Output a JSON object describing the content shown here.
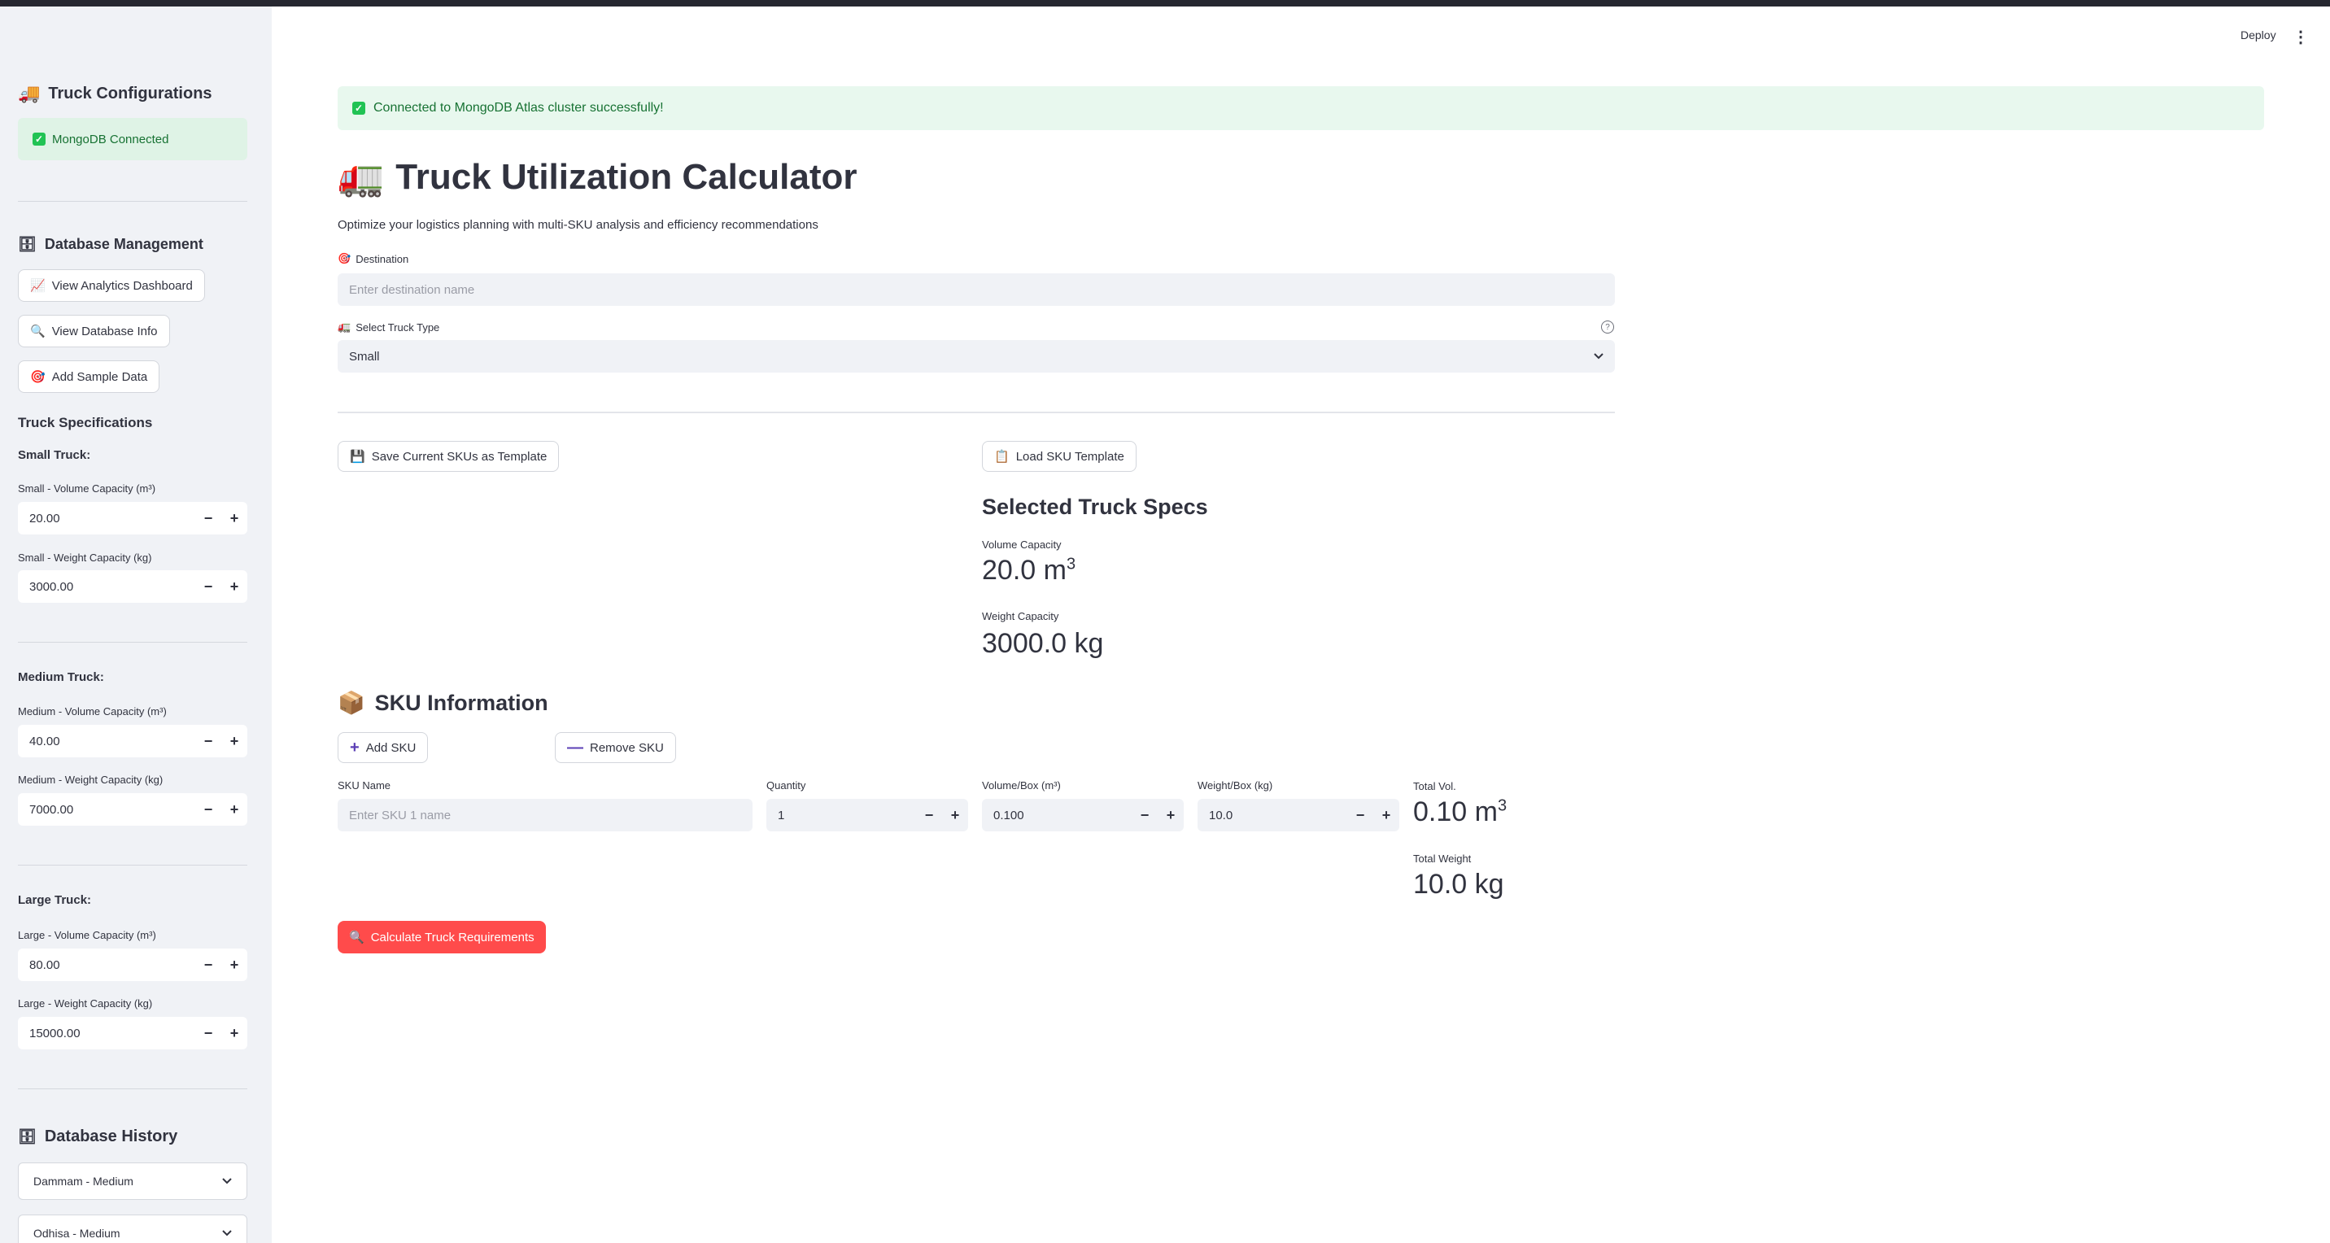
{
  "header": {
    "deploy_label": "Deploy",
    "menu_icon": "⋮"
  },
  "sidebar": {
    "title_icon": "🚚",
    "title": "Truck Configurations",
    "mongo_status": "MongoDB Connected",
    "db_mgmt_icon": "🗄",
    "db_mgmt_title": "Database Management",
    "buttons": [
      {
        "icon": "📈",
        "label": "View Analytics Dashboard"
      },
      {
        "icon": "🔍",
        "label": "View Database Info"
      },
      {
        "icon": "🎯",
        "label": "Add Sample Data"
      }
    ],
    "specs_title": "Truck Specifications",
    "small": {
      "title": "Small Truck:",
      "vol_label": "Small - Volume Capacity (m³)",
      "vol_value": "20.00",
      "wt_label": "Small - Weight Capacity (kg)",
      "wt_value": "3000.00"
    },
    "medium": {
      "title": "Medium Truck:",
      "vol_label": "Medium - Volume Capacity (m³)",
      "vol_value": "40.00",
      "wt_label": "Medium - Weight Capacity (kg)",
      "wt_value": "7000.00"
    },
    "large": {
      "title": "Large Truck:",
      "vol_label": "Large - Volume Capacity (m³)",
      "vol_value": "80.00",
      "wt_label": "Large - Weight Capacity (kg)",
      "wt_value": "15000.00"
    },
    "history_icon": "🗄",
    "history_title": "Database History",
    "history_items": [
      "Dammam - Medium",
      "Odhisa - Medium"
    ]
  },
  "main": {
    "alert": "Connected to MongoDB Atlas cluster successfully!",
    "title_icon": "🚛",
    "title": "Truck Utilization Calculator",
    "caption": "Optimize your logistics planning with multi-SKU analysis and efficiency recommendations",
    "destination_icon": "🎯",
    "destination_label": "Destination",
    "destination_placeholder": "Enter destination name",
    "truck_type_icon": "🚛",
    "truck_type_label": "Select Truck Type",
    "truck_type_value": "Small",
    "save_template_icon": "💾",
    "save_template_label": "Save Current SKUs as Template",
    "load_template_icon": "📋",
    "load_template_label": "Load SKU Template",
    "specs_title": "Selected Truck Specs",
    "volume_capacity_label": "Volume Capacity",
    "volume_capacity_value": "20.0 m",
    "volume_capacity_sup": "3",
    "weight_capacity_label": "Weight Capacity",
    "weight_capacity_value": "3000.0 kg",
    "sku_icon": "📦",
    "sku_title": "SKU Information",
    "add_sku_label": "Add SKU",
    "remove_sku_label": "Remove SKU",
    "sku_columns": {
      "name": "SKU Name",
      "quantity": "Quantity",
      "volume": "Volume/Box (m³)",
      "weight": "Weight/Box (kg)",
      "total_vol": "Total Vol.",
      "total_weight": "Total Weight"
    },
    "sku_row": {
      "name_placeholder": "Enter SKU 1 name",
      "quantity": "1",
      "volume": "0.100",
      "weight": "10.0",
      "total_vol": "0.10 m",
      "total_vol_sup": "3",
      "total_weight": "10.0 kg"
    },
    "calculate_icon": "🔍",
    "calculate_label": "Calculate Truck Requirements"
  },
  "colors": {
    "primary": "#ff4b4b",
    "success_bg": "#dff3e6",
    "success_text": "#177233",
    "sidebar_bg": "#f0f2f6"
  }
}
